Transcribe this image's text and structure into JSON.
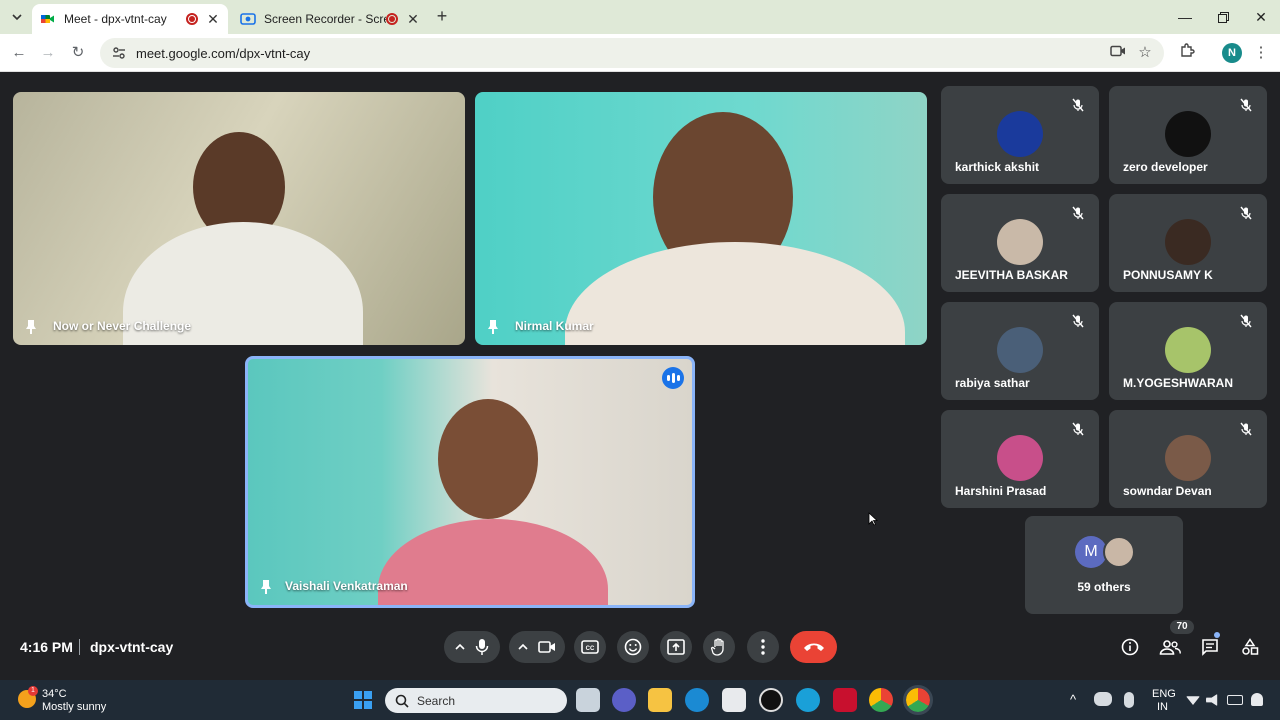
{
  "browser": {
    "tabs": [
      {
        "title": "Meet - dpx-vtnt-cay",
        "active": true
      },
      {
        "title": "Screen Recorder - Scre.io",
        "active": false
      }
    ],
    "url": "meet.google.com/dpx-vtnt-cay",
    "profile_initial": "N"
  },
  "meet": {
    "main_tiles": [
      {
        "name": "Now or Never Challenge"
      },
      {
        "name": "Nirmal Kumar"
      },
      {
        "name": "Vaishali Venkatraman"
      }
    ],
    "participants": [
      {
        "name": "karthick akshit",
        "color": "#1a3a9c"
      },
      {
        "name": "zero developer",
        "color": "#111111"
      },
      {
        "name": "JEEVITHA BASKAR",
        "color": "#c9b9a8"
      },
      {
        "name": "PONNUSAMY K",
        "color": "#3a2a22"
      },
      {
        "name": "rabiya sathar",
        "color": "#4a5f78"
      },
      {
        "name": "M.YOGESHWARAN",
        "color": "#a7c46a"
      },
      {
        "name": "Harshini Prasad",
        "color": "#c84f8a"
      },
      {
        "name": "sowndar Devan",
        "color": "#7a5a48"
      }
    ],
    "others_label": "59 others",
    "others_initial": "M",
    "time": "4:16 PM",
    "meeting_code": "dpx-vtnt-cay",
    "people_count": "70"
  },
  "taskbar": {
    "temperature": "34°C",
    "weather": "Mostly sunny",
    "weather_badge": "1",
    "search_placeholder": "Search",
    "lang_line1": "ENG",
    "lang_line2": "IN"
  }
}
